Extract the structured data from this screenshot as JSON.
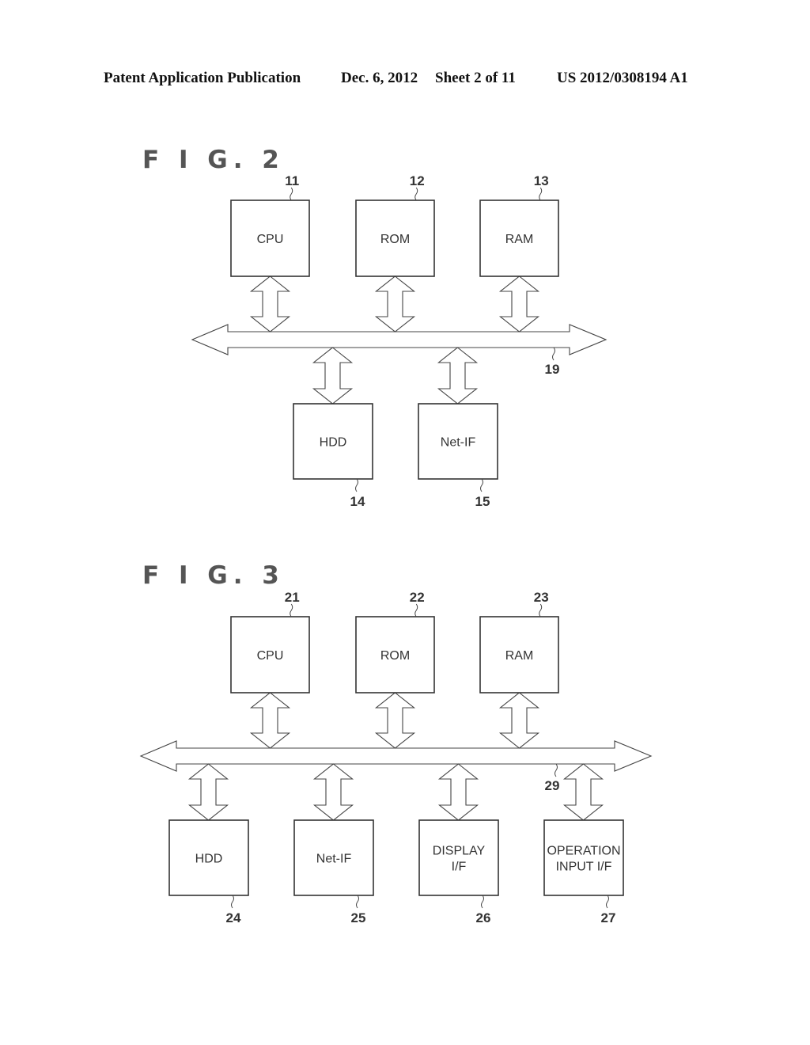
{
  "header": {
    "publication": "Patent Application Publication",
    "date": "Dec. 6, 2012",
    "sheet": "Sheet 2 of 11",
    "number": "US 2012/0308194 A1"
  },
  "figures": [
    {
      "title": "F I G. 2",
      "bus_ref": "19",
      "top_blocks": [
        {
          "label": [
            "CPU"
          ],
          "ref": "11"
        },
        {
          "label": [
            "ROM"
          ],
          "ref": "12"
        },
        {
          "label": [
            "RAM"
          ],
          "ref": "13"
        }
      ],
      "bottom_blocks": [
        {
          "label": [
            "HDD"
          ],
          "ref": "14"
        },
        {
          "label": [
            "Net-IF"
          ],
          "ref": "15"
        }
      ]
    },
    {
      "title": "F I G. 3",
      "bus_ref": "29",
      "top_blocks": [
        {
          "label": [
            "CPU"
          ],
          "ref": "21"
        },
        {
          "label": [
            "ROM"
          ],
          "ref": "22"
        },
        {
          "label": [
            "RAM"
          ],
          "ref": "23"
        }
      ],
      "bottom_blocks": [
        {
          "label": [
            "HDD"
          ],
          "ref": "24"
        },
        {
          "label": [
            "Net-IF"
          ],
          "ref": "25"
        },
        {
          "label": [
            "DISPLAY",
            "I/F"
          ],
          "ref": "26"
        },
        {
          "label": [
            "OPERATION",
            "INPUT I/F"
          ],
          "ref": "27"
        }
      ]
    }
  ]
}
